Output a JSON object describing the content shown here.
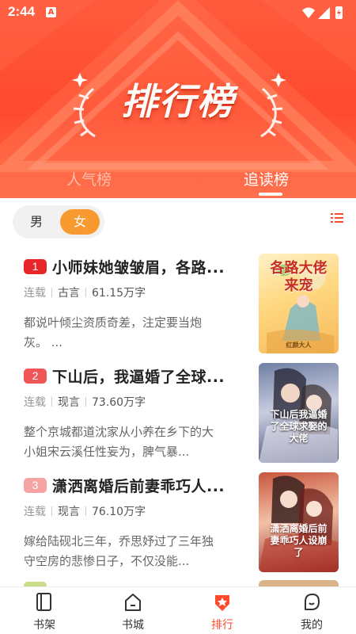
{
  "status_bar": {
    "time": "2:44",
    "badge": "A"
  },
  "header": {
    "title": "排行榜",
    "tabs": [
      {
        "label": "人气榜",
        "active": false
      },
      {
        "label": "追读榜",
        "active": true
      }
    ]
  },
  "gender": {
    "male": "男",
    "female": "女",
    "selected": "女"
  },
  "colors": {
    "accent": "#ff4a2e",
    "gender_active": "#f89a2f",
    "rank1": "#e8262a",
    "rank2": "#f05656",
    "rank3": "#f6a3a3"
  },
  "books": [
    {
      "rank": "1",
      "title": "小师妹她皱皱眉，各路...",
      "status": "连载",
      "genre": "古言",
      "words": "61.15万字",
      "desc": "都说叶倾尘资质奇差，注定要当炮灰。 ...",
      "cover_text": "各路大佬来宠",
      "cover_author": "红颜大人"
    },
    {
      "rank": "2",
      "title": "下山后，我逼婚了全球...",
      "status": "连载",
      "genre": "现言",
      "words": "73.60万字",
      "desc": "整个京城都道沈家从小养在乡下的大小姐宋云溪任性妄为，脾气暴...",
      "cover_text": "下山后我逼婚了全球求娶的大佬",
      "cover_author": ""
    },
    {
      "rank": "3",
      "title": "潇洒离婚后前妻乖巧人...",
      "status": "连载",
      "genre": "现言",
      "words": "76.10万字",
      "desc": "嫁给陆砚北三年，乔思妤过了三年独守空房的悲惨日子，不仅没能...",
      "cover_text": "潇洒离婚后前妻乖巧人设崩了",
      "cover_author": ""
    }
  ],
  "bottom_nav": [
    {
      "label": "书架",
      "icon": "bookshelf-icon",
      "active": false
    },
    {
      "label": "书城",
      "icon": "bookstore-icon",
      "active": false
    },
    {
      "label": "排行",
      "icon": "ranking-icon",
      "active": true
    },
    {
      "label": "我的",
      "icon": "profile-icon",
      "active": false
    }
  ]
}
